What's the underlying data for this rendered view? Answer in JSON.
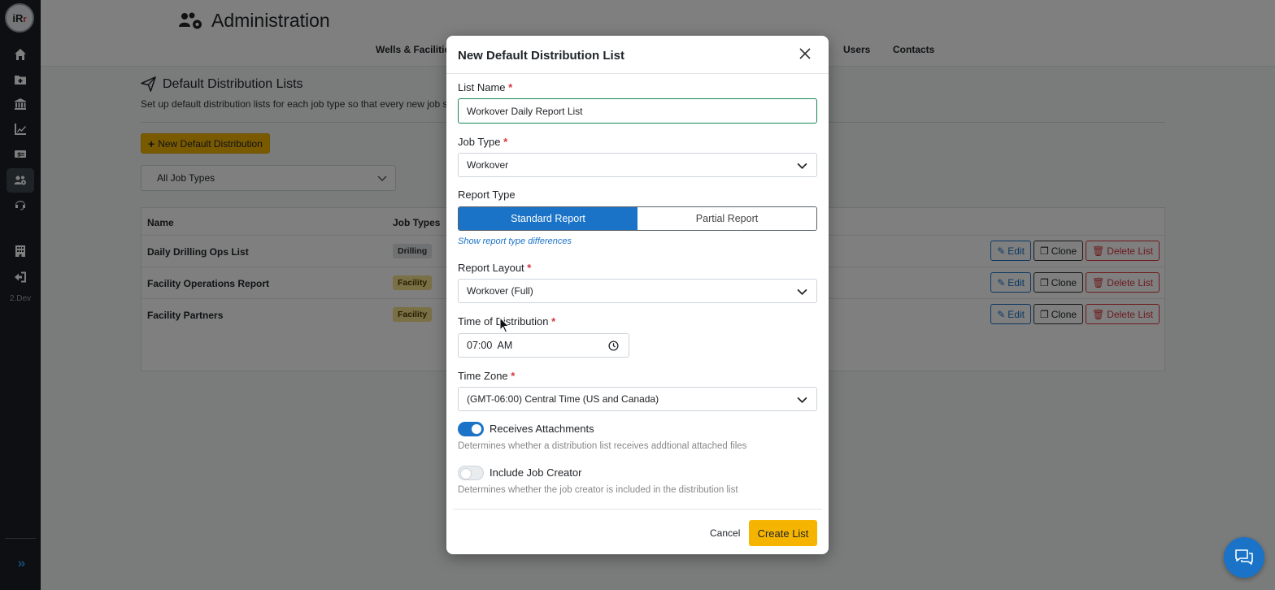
{
  "sidebar": {
    "logo_text": "iR",
    "logo_accent": "r",
    "version": "2.Dev",
    "icons": [
      "home-icon",
      "folder-icon",
      "institution-icon",
      "chart-line-icon",
      "money-icon",
      "users-cog-icon",
      "headset-icon",
      "building-icon",
      "sign-out-icon"
    ]
  },
  "header": {
    "title": "Administration",
    "nav": [
      "Wells & Facilities",
      "Users",
      "Contacts"
    ]
  },
  "section": {
    "title": "Default Distribution Lists",
    "description": "Set up default distribution lists for each job type so that every new job s",
    "new_button": "New Default Distribution",
    "filter_value": "All Job Types"
  },
  "table": {
    "columns": [
      "Name",
      "Job Types"
    ],
    "rows": [
      {
        "name": "Daily Drilling Ops List",
        "job_type": "Drilling"
      },
      {
        "name": "Facility Operations Report",
        "job_type": "Facility"
      },
      {
        "name": "Facility Partners",
        "job_type": "Facility"
      }
    ],
    "actions": {
      "edit": "Edit",
      "clone": "Clone",
      "delete": "Delete List"
    }
  },
  "modal": {
    "title": "New Default Distribution List",
    "list_name": {
      "label": "List Name",
      "value": "Workover Daily Report List"
    },
    "job_type": {
      "label": "Job Type",
      "value": "Workover"
    },
    "report_type": {
      "label": "Report Type",
      "options": [
        "Standard Report",
        "Partial Report"
      ],
      "selected": "Standard Report",
      "help_link": "Show report type differences"
    },
    "report_layout": {
      "label": "Report Layout",
      "value": "Workover (Full)"
    },
    "time_of_distribution": {
      "label": "Time of Distribution",
      "value": "07:00  AM"
    },
    "time_zone": {
      "label": "Time Zone",
      "value": "(GMT-06:00) Central Time (US and Canada)"
    },
    "receives_attachments": {
      "label": "Receives Attachments",
      "enabled": true,
      "hint": "Determines whether a distribution list receives addtional attached files"
    },
    "include_job_creator": {
      "label": "Include Job Creator",
      "enabled": false,
      "hint": "Determines whether the job creator is included in the distribution list"
    },
    "required_mark": "*",
    "cancel": "Cancel",
    "create": "Create List"
  },
  "colors": {
    "primary": "#1a73c7",
    "accent": "#f5b400",
    "danger": "#d9363e",
    "sidebar": "#1b1f24"
  }
}
